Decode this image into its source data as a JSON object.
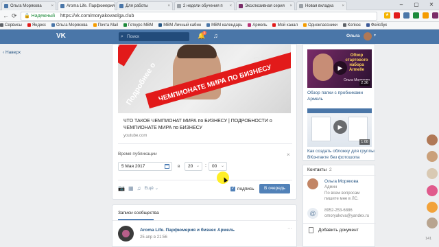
{
  "browser": {
    "tabs": [
      {
        "label": "Ольга Морякова",
        "color": "#4a76a8"
      },
      {
        "label": "Aroma Life. Парфюмерия",
        "color": "#4a76a8"
      },
      {
        "label": "Для работы",
        "color": "#4a76a8"
      },
      {
        "label": "2 недели обучения п",
        "color": "#9aa0a6"
      },
      {
        "label": "Эксклюзивная серия",
        "color": "#7a2c68"
      },
      {
        "label": "Новая вкладка",
        "color": "#9aa0a6"
      }
    ],
    "secure_label": "Надежный",
    "url": "https://vk.com/moryakovaolga.club",
    "bookmarks": [
      {
        "label": "Сервисы",
        "color": "#5f6368"
      },
      {
        "label": "Яндекс",
        "color": "#e21a1a"
      },
      {
        "label": "Ольга Морякова",
        "color": "#4a76a8"
      },
      {
        "label": "Почта Mail",
        "color": "#f59c00"
      },
      {
        "label": "Геткурс МВМ",
        "color": "#1c8a3a"
      },
      {
        "label": "МВМ Личный кабин",
        "color": "#2a5885"
      },
      {
        "label": "МВМ календарь",
        "color": "#4a76a8"
      },
      {
        "label": "Армель",
        "color": "#b83276"
      },
      {
        "label": "Мой канал",
        "color": "#e21a1a"
      },
      {
        "label": "Одноклассники",
        "color": "#f59c00"
      },
      {
        "label": "Копіює",
        "color": "#5f6368"
      },
      {
        "label": "Фейсбук",
        "color": "#3b5998"
      }
    ]
  },
  "vk": {
    "search_placeholder": "Поиск",
    "notifications_count": "2",
    "user_name": "Ольга",
    "back_link": "Наверх"
  },
  "editor": {
    "image_text_1": "Подробнее о",
    "image_text_2": "ЧЕМПИОНАТЕ МИРА ПО БИЗНЕСУ",
    "image_watermark": "ati",
    "link_title": "ЧТО ТАКОЕ ЧЕМПИОНАТ МИРА по БИЗНЕСУ | ПОДРОБНОСТИ о ЧЕМПИОНАТЕ МИРА по БИЗНЕСУ",
    "link_domain": "youtube.com",
    "publish_label": "Время публикации",
    "date": "5 Мая 2017",
    "at_label": "в",
    "hour": "20",
    "minute": "00",
    "more_label": "Ещё",
    "signature_label": "подпись",
    "queue_button": "В очередь"
  },
  "posts": {
    "tab_label": "Записи сообщества",
    "author": "Aroma Life. Парфюмерия и бизнес Армель",
    "date": "25 апр в 21:56"
  },
  "right": {
    "video1": {
      "overlay": "Обзор стартового набора Armelle",
      "overlay_name": "Ольга Морякова",
      "duration": "2:36",
      "caption": "Обзор папки с пробниками Армель"
    },
    "video2": {
      "duration": "1:08",
      "caption": "Как создать обложку для группы ВКонтакте без фотошопа"
    },
    "contacts": {
      "title": "Контакты",
      "count": "2",
      "person_name": "Ольга Морякова",
      "person_role": "Админ",
      "person_note": "По всем вопросам пишите мне в ЛС.",
      "phone": "8952-253-6886",
      "email": "omoryakova@yandex.ru"
    },
    "add_document": "Добавить документ"
  },
  "friends_bar": {
    "avatars": [
      {
        "color": "#b07856"
      },
      {
        "color": "#caa07a"
      },
      {
        "color": "#d9c9b3"
      },
      {
        "color": "#e05a8c"
      },
      {
        "color": "#f2a23a"
      },
      {
        "color": "#b8a48f"
      },
      {
        "color": "#8aa6c4"
      }
    ],
    "count": "141"
  }
}
